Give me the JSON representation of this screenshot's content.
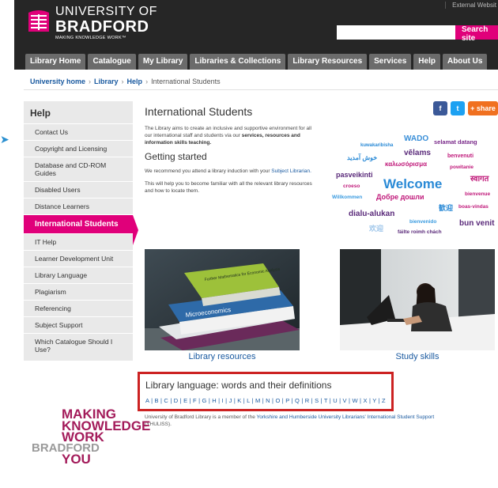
{
  "header": {
    "logo_line1": "UNIVERSITY OF",
    "logo_line2": "BRADFORD",
    "logo_tagline": "MAKING KNOWLEDGE WORK™",
    "external_link": "External Websit",
    "search_placeholder": "",
    "search_button": "Search site"
  },
  "nav": {
    "tabs": [
      "Library Home",
      "Catalogue",
      "My Library",
      "Libraries & Collections",
      "Library Resources",
      "Services",
      "Help",
      "About Us"
    ]
  },
  "breadcrumb": {
    "items": [
      "University home",
      "Library",
      "Help",
      "International Students"
    ],
    "separator": "›"
  },
  "sidebar": {
    "heading": "Help",
    "items": [
      "Contact Us",
      "Copyright and Licensing",
      "Database and CD-ROM Guides",
      "Disabled Users",
      "Distance Learners",
      "International Students",
      "IT Help",
      "Learner Development Unit",
      "Library Language",
      "Plagiarism",
      "Referencing",
      "Subject Support",
      "Which Catalogue Should I Use?"
    ],
    "active_index": 5
  },
  "main": {
    "title": "International Students",
    "intro_a": "The Library aims to create an inclusive and supportive environment for all our international staff and students via our ",
    "intro_bold": "services, resources and information skills teaching.",
    "getting_started": "Getting started",
    "p1_a": "We recommend you attend a library induction with your ",
    "p1_link": "Subject Librarian.",
    "p2": "This will help you to become familiar with all the relevant library resources and how to locate them.",
    "share": {
      "facebook": "f",
      "twitter": "t",
      "share": "+ share"
    },
    "tiles": [
      {
        "caption": "Library resources",
        "book1": "Further Mathematics for Economic Analysis",
        "book2": "Microeconomics"
      },
      {
        "caption": "Study skills"
      }
    ],
    "glossary_title": "Library language: words and their definitions",
    "glossary_letters": "A | B | C | D | E | F | G | H | I | J | K | L | M | N | O | P | Q | R | S | T | U | V | W | X | Y | Z",
    "member_a": "University of Bradford Library is a member of the ",
    "member_link": "Yorkshire and Humberside University Librarians' International Student Support",
    "member_b": " (YHULISS)."
  },
  "wordcloud": [
    {
      "text": "WADO",
      "color": "#3a8fd8"
    },
    {
      "text": "selamat datang",
      "color": "#7a2a8a"
    },
    {
      "text": "kuwakaribisha",
      "color": "#2a8ad6"
    },
    {
      "text": "vēlams",
      "color": "#5a2a7a"
    },
    {
      "text": "benvenuti",
      "color": "#c0197a"
    },
    {
      "text": "خوش آمدید",
      "color": "#2a8ad6"
    },
    {
      "text": "καλωσόρισμα",
      "color": "#c0197a"
    },
    {
      "text": "powitanie",
      "color": "#c0197a"
    },
    {
      "text": "pasveikinti",
      "color": "#5a2a7a"
    },
    {
      "text": "स्वागत",
      "color": "#c0197a"
    },
    {
      "text": "Welcome",
      "color": "#2a8ad6"
    },
    {
      "text": "croeso",
      "color": "#c0197a"
    },
    {
      "text": "bienvenue",
      "color": "#c0197a"
    },
    {
      "text": "Willkommen",
      "color": "#3a9be0"
    },
    {
      "text": "Добре дошли",
      "color": "#c0197a"
    },
    {
      "text": "歓迎",
      "color": "#2a8ad6"
    },
    {
      "text": "boas-vindas",
      "color": "#c0197a"
    },
    {
      "text": "dialu-alukan",
      "color": "#5a2a7a"
    },
    {
      "text": "bienvenido",
      "color": "#3a9be0"
    },
    {
      "text": "bun venit",
      "color": "#5a2a7a"
    },
    {
      "text": "欢迎",
      "color": "#9fc6ea"
    },
    {
      "text": "fáilte roimh chách",
      "color": "#5a2a7a"
    }
  ],
  "footer_logo": [
    "MAKING",
    "KNOWLEDGE",
    "WORK",
    "BRADFORD",
    "YOU"
  ],
  "colors": {
    "accent": "#e0007a",
    "link": "#1a5aa0",
    "dark": "#262626",
    "highlight": "#cc2222"
  }
}
